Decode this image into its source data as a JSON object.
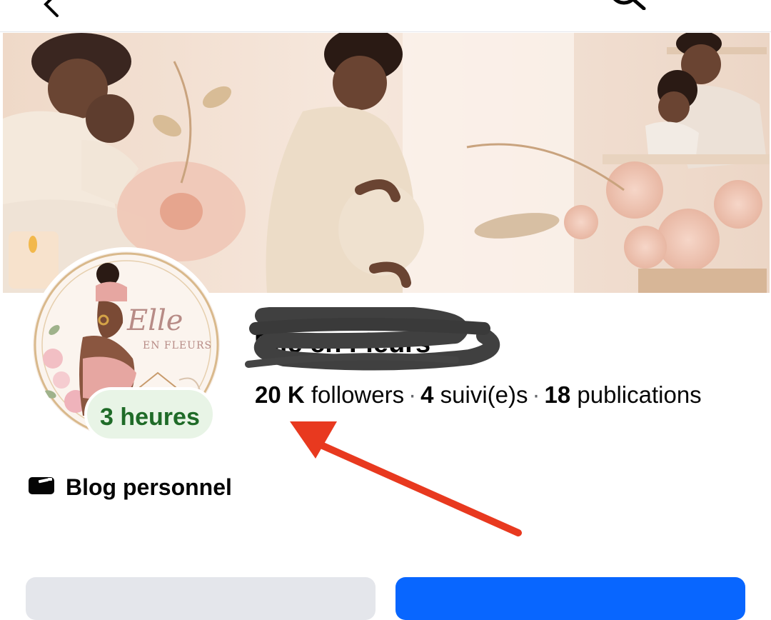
{
  "profile": {
    "name": "Elle en Fleurs",
    "logo": {
      "script": "Elle",
      "subtitle": "EN FLEURS"
    }
  },
  "story_badge": "3 heures",
  "stats": {
    "followers_count": "20 K",
    "followers_label": "followers",
    "following_count": "4",
    "following_label": "suivi(e)s",
    "posts_count": "18",
    "posts_label": "publications",
    "separator": "·"
  },
  "category": {
    "label": "Blog personnel",
    "icon": "video-camera-icon"
  },
  "colors": {
    "accent_blue": "#0866ff",
    "badge_green": "#1f6b28",
    "badge_bg": "#e8f4e6",
    "arrow_red": "#e8391f",
    "secondary_button": "#e4e6eb"
  },
  "icons": {
    "back": "back-arrow-icon",
    "search": "search-icon"
  }
}
